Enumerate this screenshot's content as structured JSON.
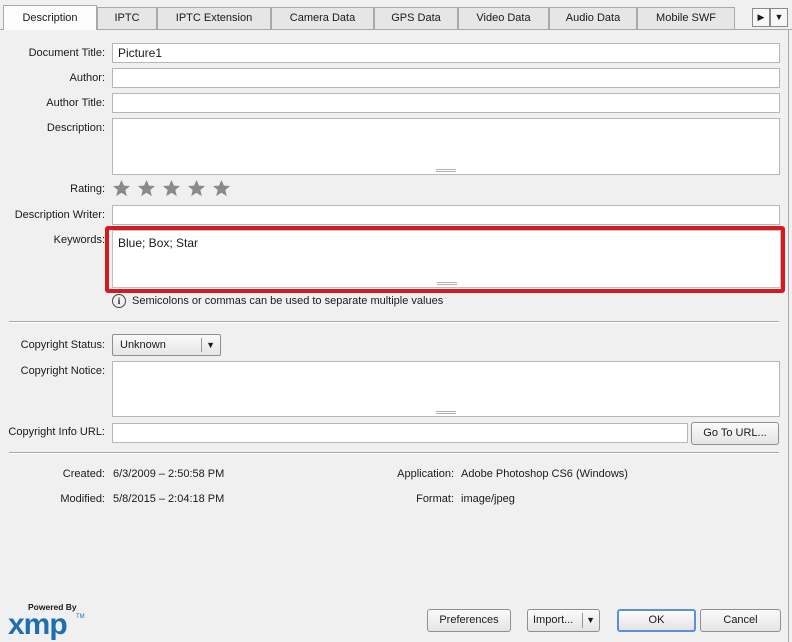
{
  "tabs": [
    {
      "label": "Description",
      "active": true
    },
    {
      "label": "IPTC",
      "active": false
    },
    {
      "label": "IPTC Extension",
      "active": false
    },
    {
      "label": "Camera Data",
      "active": false
    },
    {
      "label": "GPS Data",
      "active": false
    },
    {
      "label": "Video Data",
      "active": false
    },
    {
      "label": "Audio Data",
      "active": false
    },
    {
      "label": "Mobile SWF",
      "active": false
    }
  ],
  "tab_scroll": {
    "next_glyph": "▶",
    "menu_glyph": "▼"
  },
  "description": {
    "document_title": {
      "label": "Document Title:",
      "value": "Picture1"
    },
    "author": {
      "label": "Author:",
      "value": ""
    },
    "author_title": {
      "label": "Author Title:",
      "value": ""
    },
    "description": {
      "label": "Description:",
      "value": ""
    },
    "rating": {
      "label": "Rating:",
      "stars_total": 5,
      "stars_set": 0,
      "icon": "star-icon"
    },
    "description_writer": {
      "label": "Description Writer:",
      "value": ""
    },
    "keywords": {
      "label": "Keywords:",
      "value": "Blue; Box; Star",
      "highlight_color": "#d71920"
    },
    "hint": {
      "icon": "info-icon",
      "glyph": "i",
      "text": "Semicolons or commas can be used to separate multiple values"
    }
  },
  "copyright": {
    "status": {
      "label": "Copyright Status:",
      "value": "Unknown",
      "arrow": "▼"
    },
    "notice": {
      "label": "Copyright Notice:",
      "value": ""
    },
    "info_url": {
      "label": "Copyright Info URL:",
      "value": "",
      "button": "Go To URL..."
    }
  },
  "metadata": {
    "created": {
      "label": "Created:",
      "value": "6/3/2009 – 2:50:58 PM"
    },
    "modified": {
      "label": "Modified:",
      "value": "5/8/2015 – 2:04:18 PM"
    },
    "application": {
      "label": "Application:",
      "value": "Adobe Photoshop CS6 (Windows)"
    },
    "format": {
      "label": "Format:",
      "value": "image/jpeg"
    }
  },
  "footer": {
    "logo_powered": "Powered By",
    "logo_xmp": "xmp",
    "logo_tm": "TM",
    "preferences": "Preferences",
    "import": "Import...",
    "import_arrow": "▼",
    "ok": "OK",
    "cancel": "Cancel"
  },
  "colors": {
    "accent": "#5d8fd6",
    "highlight": "#d71920",
    "logo": "#1f6fb0"
  }
}
